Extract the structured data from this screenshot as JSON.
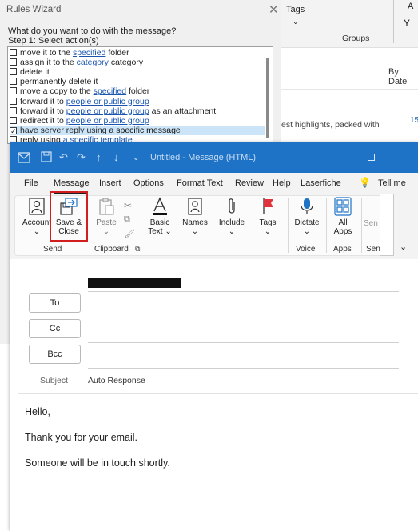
{
  "background_window": {
    "tags_label": "Tags",
    "tags_chevron": "⌄",
    "groups_label": "Groups",
    "sort_label": "By Date",
    "preview_snippet": "est highlights, packed with",
    "number_badge": "15"
  },
  "rules_wizard": {
    "title": "Rules Wizard",
    "question": "What do you want to do with the message?",
    "step_label": "Step 1: Select action(s)",
    "actions": [
      {
        "pre": "move it to the ",
        "link": "specified",
        "post": " folder",
        "checked": false
      },
      {
        "pre": "assign it to the ",
        "link": "category",
        "post": " category",
        "checked": false
      },
      {
        "pre": "delete it",
        "link": "",
        "post": "",
        "checked": false
      },
      {
        "pre": "permanently delete it",
        "link": "",
        "post": "",
        "checked": false
      },
      {
        "pre": "move a copy to the ",
        "link": "specified",
        "post": " folder",
        "checked": false
      },
      {
        "pre": "forward it to ",
        "link": "people or public group",
        "post": "",
        "checked": false
      },
      {
        "pre": "forward it to ",
        "link": "people or public group",
        "post": " as an attachment",
        "checked": false
      },
      {
        "pre": "redirect it to ",
        "link": "people or public group",
        "post": "",
        "checked": false
      },
      {
        "pre": "have server reply using ",
        "link": "a specific message",
        "post": "",
        "checked": true
      },
      {
        "pre": "reply using ",
        "link": "a specific template",
        "post": "",
        "checked": false
      }
    ]
  },
  "message_window": {
    "title": "Untitled  -  Message (HTML)",
    "menu": [
      "File",
      "Message",
      "Insert",
      "Options",
      "Format Text",
      "Review",
      "Help",
      "Laserfiche"
    ],
    "tell_me": "Tell me",
    "ribbon": {
      "account_label": "Account",
      "save_close_label_1": "Save &",
      "save_close_label_2": "Close",
      "paste_label": "Paste",
      "basic_text_label_1": "Basic",
      "basic_text_label_2": "Text",
      "names_label": "Names",
      "include_label": "Include",
      "tags_label": "Tags",
      "dictate_label": "Dictate",
      "all_apps_label_1": "All",
      "all_apps_label_2": "Apps",
      "sensitivity_label": "Sen",
      "groups": {
        "send": "Send",
        "clipboard": "Clipboard",
        "voice": "Voice",
        "apps": "Apps",
        "sensitivity": "Sen"
      }
    },
    "fields": {
      "to_label": "To",
      "cc_label": "Cc",
      "bcc_label": "Bcc",
      "subject_label": "Subject",
      "subject_value": "Auto Response"
    },
    "body": {
      "line1": "Hello,",
      "line2": "Thank you for your email.",
      "line3": "Someone will be in touch shortly."
    }
  },
  "colors": {
    "titlebar": "#1e73c6",
    "highlight_box": "#d11f1f",
    "link": "#1a56b0",
    "selected_row": "#cce4f7"
  }
}
